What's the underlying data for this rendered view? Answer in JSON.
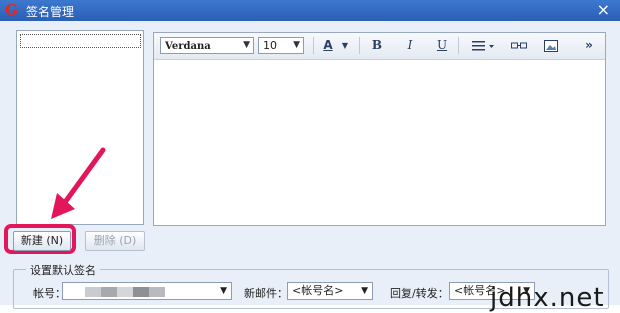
{
  "window": {
    "title": "签名管理",
    "app_icon": "foxmail-icon",
    "close_glyph": "×"
  },
  "editor": {
    "font_family": "Verdana",
    "font_size": "10",
    "toolbar": {
      "font_color_glyph": "A",
      "bold": "B",
      "italic": "I",
      "underline": "U",
      "more": "»"
    }
  },
  "buttons": {
    "new": "新建 (N)",
    "delete": "删除 (D)"
  },
  "default_signature": {
    "legend": "设置默认签名",
    "account_label": "帐号：",
    "new_mail_label": "新邮件：",
    "new_mail_value": "<帐号名>",
    "reply_label": "回复/转发：",
    "reply_value": "<帐号名>"
  },
  "annotation": {
    "arrow_color": "#e3165c"
  },
  "watermark": "jdhx.net"
}
